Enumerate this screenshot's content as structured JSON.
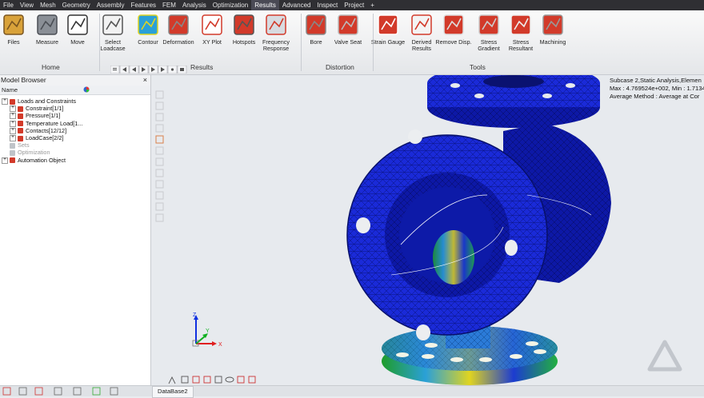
{
  "menu": [
    "File",
    "View",
    "Mesh",
    "Geometry",
    "Assembly",
    "Features",
    "FEM",
    "Analysis",
    "Optimization",
    "Results",
    "Advanced",
    "Inspect",
    "Project",
    "+"
  ],
  "menu_active": "Results",
  "ribbon": {
    "buttons": [
      {
        "label": "Files",
        "icon": "files-icon"
      },
      {
        "label": "Measure",
        "icon": "measure-icon"
      },
      {
        "label": "Move",
        "icon": "move-icon"
      },
      {
        "label": "Select Loadcase",
        "icon": "select-loadcase-icon"
      },
      {
        "label": "Contour",
        "icon": "contour-icon"
      },
      {
        "label": "Deformation",
        "icon": "deformation-icon"
      },
      {
        "label": "XY Plot",
        "icon": "xy-plot-icon"
      },
      {
        "label": "Hotspots",
        "icon": "hotspots-icon"
      },
      {
        "label": "Frequency Response",
        "icon": "frequency-response-icon"
      },
      {
        "label": "Bore",
        "icon": "bore-icon"
      },
      {
        "label": "Valve Seat",
        "icon": "valve-seat-icon"
      },
      {
        "label": "Strain Gauge",
        "icon": "strain-gauge-icon"
      },
      {
        "label": "Derived Results",
        "icon": "derived-results-icon"
      },
      {
        "label": "Remove Disp.",
        "icon": "remove-disp-icon"
      },
      {
        "label": "Stress Gradient",
        "icon": "stress-gradient-icon"
      },
      {
        "label": "Stress Resultant",
        "icon": "stress-resultant-icon"
      },
      {
        "label": "Machining",
        "icon": "machining-icon"
      }
    ],
    "groups": [
      "Home",
      "Results",
      "Distortion",
      "Tools"
    ]
  },
  "model_browser": {
    "title": "Model Browser",
    "column": "Name",
    "items": [
      {
        "label": "Loads and Constraints",
        "level": 0,
        "dim": false
      },
      {
        "label": "Constraint[1/1]",
        "level": 1,
        "dim": false
      },
      {
        "label": "Pressure[1/1]",
        "level": 1,
        "dim": false
      },
      {
        "label": "Temperature Load[1...",
        "level": 1,
        "dim": false
      },
      {
        "label": "Contacts[12/12]",
        "level": 1,
        "dim": false
      },
      {
        "label": "LoadCase[2/2]",
        "level": 1,
        "dim": false
      },
      {
        "label": "Sets",
        "level": 0,
        "dim": true
      },
      {
        "label": "Optimization",
        "level": 0,
        "dim": true
      },
      {
        "label": "Automation Object",
        "level": 0,
        "dim": false
      }
    ]
  },
  "viewport": {
    "info_lines": [
      "Subcase 2,Static Analysis,Elemen",
      "Max : 4.769524e+002, Min : 1.7134",
      "Average Method : Average at Cor"
    ],
    "triad": {
      "x": "X",
      "y": "Y",
      "z": "Z"
    }
  },
  "statusbar": {
    "tab": "DataBase2"
  },
  "colors": {
    "mesh_blue": "#1020c8",
    "menubar_bg": "#2f2f33",
    "ribbon_accent": "#d23a2a",
    "triad_x": "#e02020",
    "triad_y": "#10b020",
    "triad_z": "#1030e0"
  }
}
